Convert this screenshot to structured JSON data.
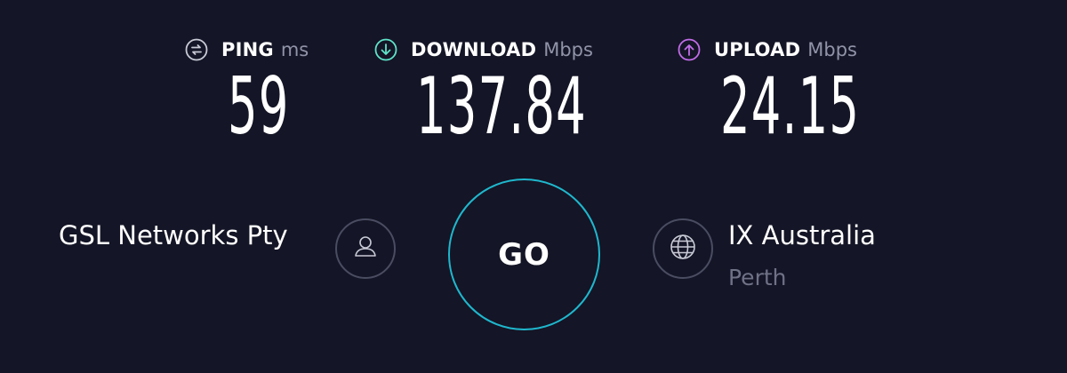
{
  "metrics": {
    "ping": {
      "label": "PING",
      "unit": "ms",
      "value": "59",
      "icon": "ping-icon",
      "color": "#c9cad6"
    },
    "download": {
      "label": "DOWNLOAD",
      "unit": "Mbps",
      "value": "137.84",
      "icon": "download-arrow-icon",
      "color": "#5ee3c9"
    },
    "upload": {
      "label": "UPLOAD",
      "unit": "Mbps",
      "value": "24.15",
      "icon": "upload-arrow-icon",
      "color": "#c16ce8"
    }
  },
  "isp": {
    "name": "GSL Networks Pty",
    "icon": "user-icon"
  },
  "go_button": {
    "label": "GO",
    "color": "#1fb7cd"
  },
  "server": {
    "name": "IX Australia",
    "location": "Perth",
    "icon": "globe-icon"
  }
}
